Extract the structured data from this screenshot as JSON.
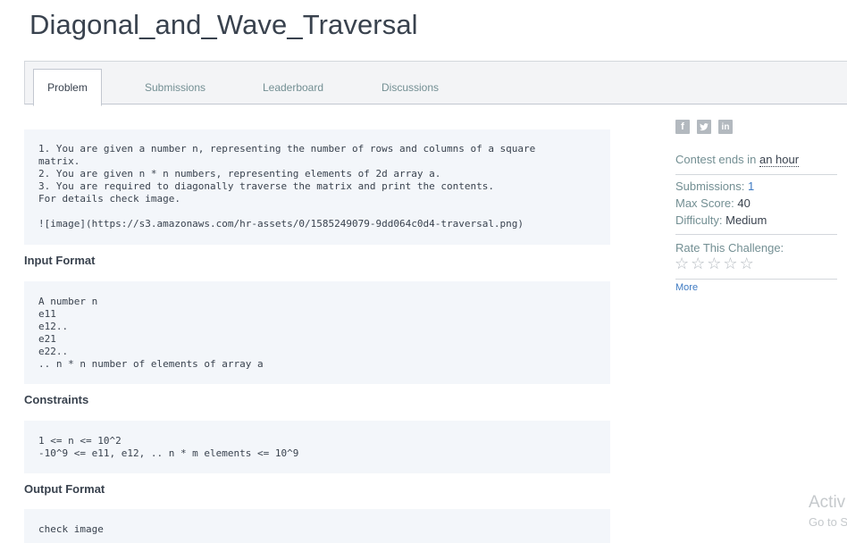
{
  "header": {
    "title": "Diagonal_and_Wave_Traversal"
  },
  "tabs": [
    {
      "label": "Problem",
      "active": true
    },
    {
      "label": "Submissions",
      "active": false
    },
    {
      "label": "Leaderboard",
      "active": false
    },
    {
      "label": "Discussions",
      "active": false
    }
  ],
  "problem": {
    "statement_lines": [
      "1. You are given a number n, representing the number of rows and columns of a square",
      "matrix.",
      "2. You are given n * n numbers, representing elements of 2d array a.",
      "3. You are required to diagonally traverse the matrix and print the contents.",
      "For details check image.",
      "",
      "![image](https://s3.amazonaws.com/hr-assets/0/1585249079-9dd064c0d4-traversal.png)"
    ],
    "input_format_heading": "Input Format",
    "input_format_lines": [
      "A number n",
      "e11",
      "e12..",
      "e21",
      "e22..",
      ".. n * n number of elements of array a"
    ],
    "constraints_heading": "Constraints",
    "constraints_lines": [
      "1 <= n <= 10^2",
      "-10^9 <= e11, e12, .. n * m elements <= 10^9"
    ],
    "output_format_heading": "Output Format",
    "output_format_lines": [
      "check image"
    ]
  },
  "sidebar": {
    "social_icons": [
      "facebook-icon",
      "twitter-icon",
      "linkedin-icon"
    ],
    "contest_prefix": "Contest ends in",
    "contest_time": "an hour",
    "submissions_label": "Submissions:",
    "submissions_value": "1",
    "max_score_label": "Max Score:",
    "max_score_value": "40",
    "difficulty_label": "Difficulty:",
    "difficulty_value": "Medium",
    "rate_label": "Rate This Challenge:",
    "star_count": 5,
    "more_label": "More"
  },
  "watermark": {
    "line1": "Activ",
    "line2": "Go to S"
  },
  "colors": {
    "accent_link": "#3e7ac2",
    "code_bg": "#f3f6fa",
    "tabbar_bg": "#f3f4f6"
  }
}
